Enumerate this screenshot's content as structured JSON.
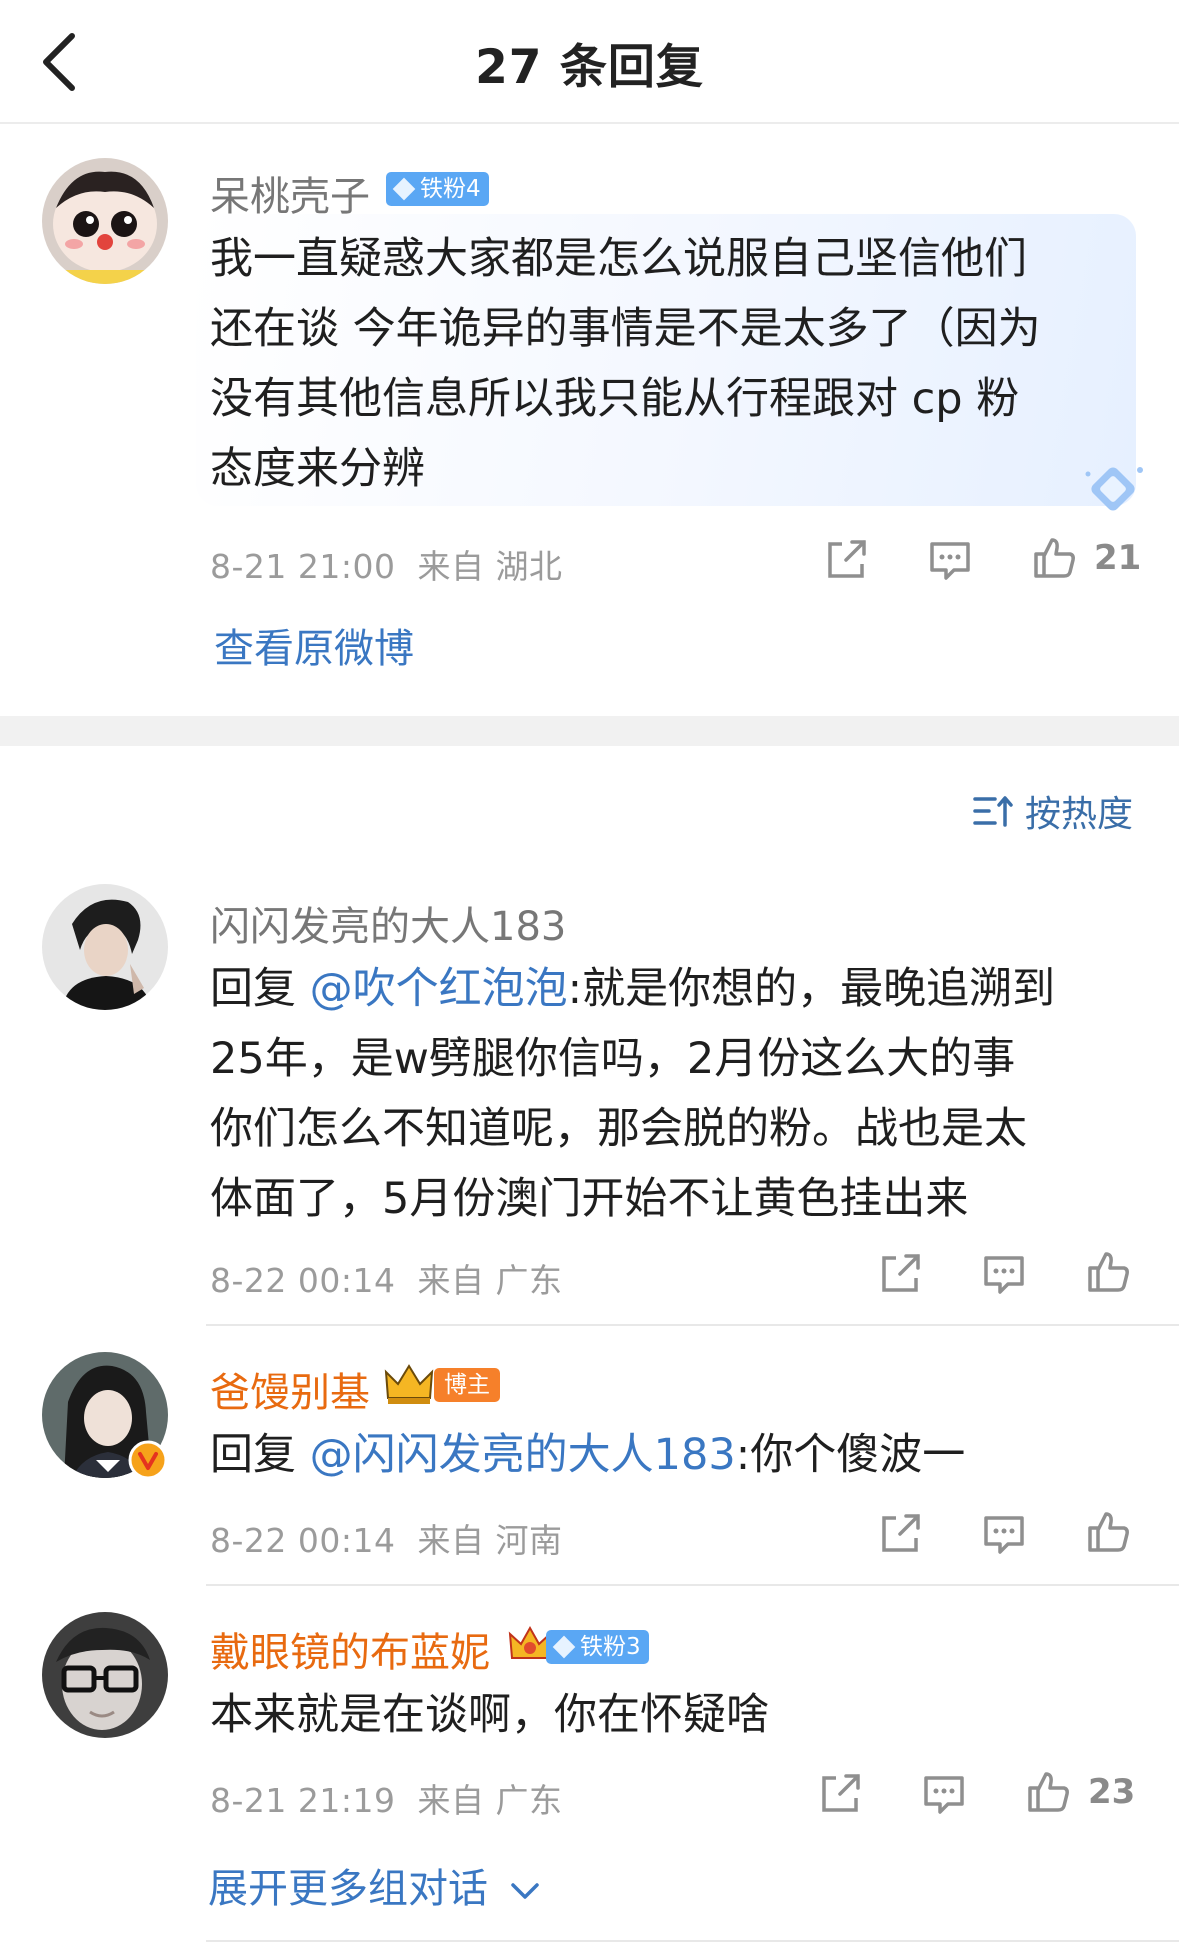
{
  "header": {
    "title": "27 条回复"
  },
  "main_comment": {
    "username": "呆桃壳子",
    "badge": "铁粉4",
    "lines": [
      "我一直疑惑大家都是怎么说服自己坚信他们",
      "还在谈 今年诡异的事情是不是太多了（因为",
      "没有其他信息所以我只能从行程跟对 cp 粉",
      "态度来分辨"
    ],
    "time": "8-21 21:00",
    "location": "来自 湖北",
    "likes": "21",
    "view_original": "查看原微博"
  },
  "sort": {
    "label": "按热度"
  },
  "replies": [
    {
      "username": "闪闪发亮的大人183",
      "reply_prefix": "回复 ",
      "mention": "@吹个红泡泡",
      "lines": [
        ":就是你想的，最晚追溯到",
        "25年，是w劈腿你信吗，2月份这么大的事",
        "你们怎么不知道呢，那会脱的粉。战也是太",
        "体面了，5月份澳门开始不让黄色挂出来"
      ],
      "time": "8-22 00:14",
      "location": "来自 广东"
    },
    {
      "username": "爸馒别基",
      "badge": "博主",
      "reply_prefix": "回复 ",
      "mention": "@闪闪发亮的大人183",
      "text": ":你个傻波一",
      "time": "8-22 00:14",
      "location": "来自 河南"
    },
    {
      "username": "戴眼镜的布蓝妮",
      "badge": "铁粉3",
      "text": "本来就是在谈啊，你在怀疑啥",
      "time": "8-21 21:19",
      "location": "来自 广东",
      "likes": "23",
      "expand": "展开更多组对话"
    }
  ],
  "colors": {
    "link_blue": "#3a77c2",
    "vip_orange": "#e86a10",
    "meta_gray": "#9b9b9b",
    "badge_blue": "#5aa7f4"
  },
  "icons": [
    "back-arrow-icon",
    "share-icon",
    "comment-icon",
    "like-icon",
    "sort-icon",
    "chevron-down-icon",
    "crown-icon",
    "verified-icon",
    "diamond-icon"
  ]
}
